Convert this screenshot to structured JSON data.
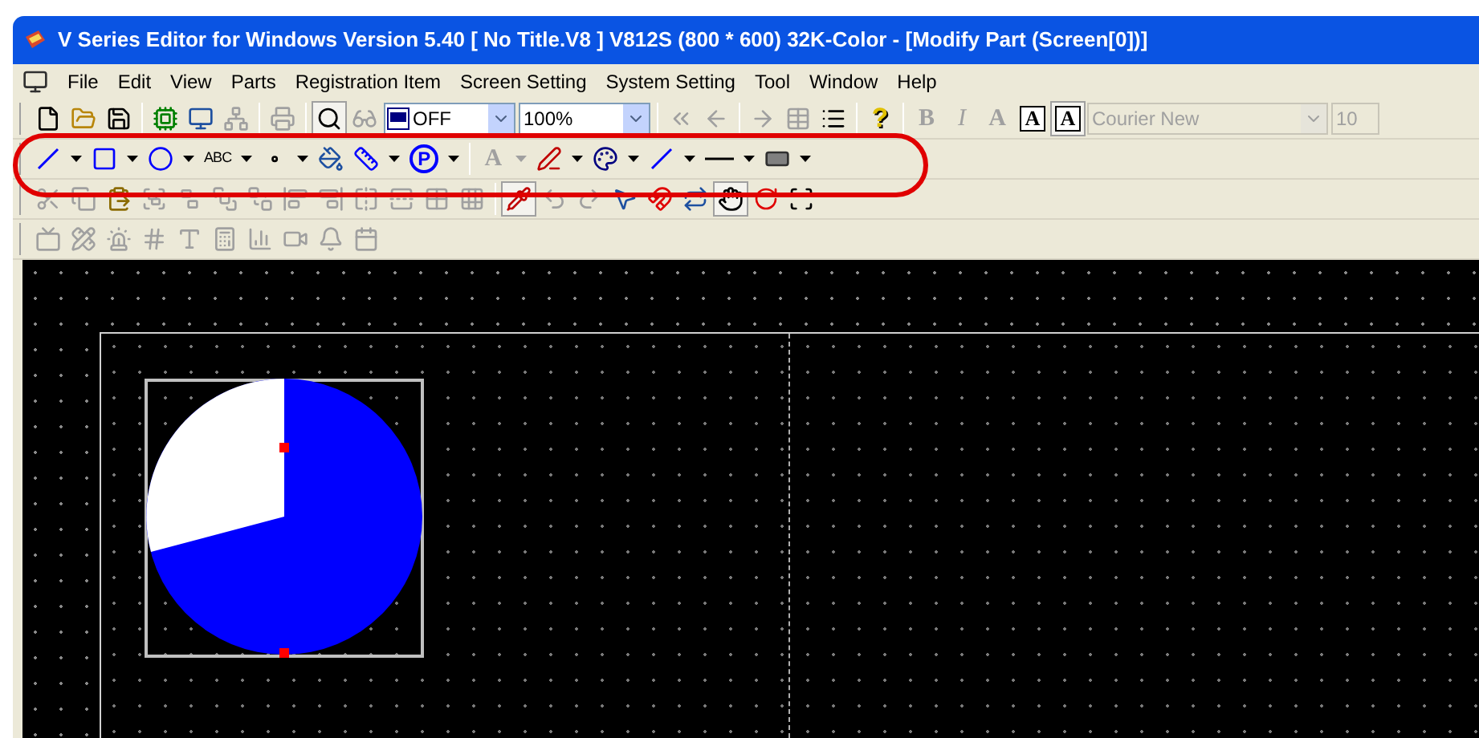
{
  "window": {
    "title": "V Series Editor for Windows Version 5.40 [ No Title.V8 ] V812S (800 * 600) 32K-Color - [Modify Part (Screen[0])]"
  },
  "menu": [
    {
      "label": "File"
    },
    {
      "label": "Edit"
    },
    {
      "label": "View"
    },
    {
      "label": "Parts"
    },
    {
      "label": "Registration Item"
    },
    {
      "label": "Screen Setting"
    },
    {
      "label": "System Setting"
    },
    {
      "label": "Tool"
    },
    {
      "label": "Window"
    },
    {
      "label": "Help"
    }
  ],
  "toolbars": [
    {
      "items": [
        {
          "kind": "file",
          "disabled": false,
          "pressed": false
        },
        {
          "kind": "folder",
          "disabled": false,
          "pressed": false
        },
        {
          "kind": "save",
          "disabled": false,
          "pressed": false
        },
        {
          "kind": "separator"
        },
        {
          "kind": "transfer",
          "disabled": false,
          "pressed": false
        },
        {
          "kind": "sim",
          "disabled": false,
          "pressed": false
        },
        {
          "kind": "network",
          "disabled": true,
          "pressed": false
        },
        {
          "kind": "separator"
        },
        {
          "kind": "printer",
          "disabled": true,
          "pressed": false
        },
        {
          "kind": "separator"
        },
        {
          "kind": "zoom",
          "disabled": false,
          "pressed": true
        },
        {
          "kind": "glasses",
          "disabled": true,
          "pressed": false
        },
        {
          "kind": "dropdown",
          "value": "OFF",
          "disabled": false,
          "icon": true
        },
        {
          "kind": "dropdown",
          "value": "100%",
          "disabled": false,
          "icon": false
        },
        {
          "kind": "separator"
        },
        {
          "kind": "rewind",
          "disabled": true,
          "pressed": false
        },
        {
          "kind": "back",
          "disabled": true,
          "pressed": false
        },
        {
          "kind": "separator"
        },
        {
          "kind": "forward",
          "disabled": true,
          "pressed": false
        },
        {
          "kind": "table",
          "disabled": true,
          "pressed": false
        },
        {
          "kind": "list",
          "disabled": false,
          "pressed": false
        },
        {
          "kind": "separator"
        },
        {
          "kind": "help",
          "text": "?",
          "disabled": false,
          "pressed": false
        },
        {
          "kind": "separator"
        },
        {
          "kind": "bold",
          "text": "B",
          "disabled": true,
          "pressed": false
        },
        {
          "kind": "italic",
          "text": "I",
          "disabled": true,
          "pressed": false
        },
        {
          "kind": "fontcolor",
          "text": "A",
          "disabled": true,
          "pressed": false
        },
        {
          "kind": "boxed",
          "text": "A",
          "disabled": false,
          "pressed": false
        },
        {
          "kind": "boxed",
          "text": "A",
          "disabled": false,
          "pressed": true
        },
        {
          "kind": "fontbox",
          "value": "Courier New",
          "disabled": true
        },
        {
          "kind": "sizebox",
          "value": "10",
          "disabled": true
        }
      ]
    },
    {
      "items": [
        {
          "kind": "line",
          "disabled": false,
          "pressed": false,
          "caret": true
        },
        {
          "kind": "rect",
          "disabled": false,
          "pressed": false,
          "caret": true
        },
        {
          "kind": "circle",
          "disabled": false,
          "pressed": false,
          "caret": true
        },
        {
          "kind": "textglyph",
          "text": "ABC",
          "disabled": false,
          "pressed": false,
          "caret": true
        },
        {
          "kind": "dot",
          "disabled": false,
          "pressed": false,
          "caret": true
        },
        {
          "kind": "paint",
          "disabled": false,
          "pressed": false
        },
        {
          "kind": "scale",
          "disabled": false,
          "pressed": false,
          "caret": true
        },
        {
          "kind": "pcircle",
          "text": "P",
          "disabled": false,
          "pressed": false,
          "caret": true
        },
        {
          "kind": "separator"
        },
        {
          "kind": "fontcolor",
          "text": "A",
          "disabled": true,
          "pressed": false,
          "caret": true
        },
        {
          "kind": "pen",
          "disabled": false,
          "pressed": false,
          "caret": true
        },
        {
          "kind": "palette",
          "disabled": false,
          "pressed": false,
          "caret": true
        },
        {
          "kind": "line",
          "disabled": false,
          "pressed": false,
          "caret": true
        },
        {
          "kind": "hline",
          "disabled": false,
          "pressed": false,
          "caret": true
        },
        {
          "kind": "fillrect",
          "disabled": false,
          "pressed": false,
          "caret": true
        }
      ]
    },
    {
      "items": [
        {
          "kind": "cut",
          "disabled": true,
          "pressed": false
        },
        {
          "kind": "copy",
          "disabled": true,
          "pressed": false
        },
        {
          "kind": "paste",
          "disabled": false,
          "pressed": false
        },
        {
          "kind": "group",
          "disabled": true,
          "pressed": false
        },
        {
          "kind": "ungroup",
          "disabled": true,
          "pressed": false
        },
        {
          "kind": "front",
          "disabled": true,
          "pressed": false
        },
        {
          "kind": "tail",
          "disabled": true,
          "pressed": false
        },
        {
          "kind": "alignl",
          "disabled": true,
          "pressed": false
        },
        {
          "kind": "alignr",
          "disabled": true,
          "pressed": false
        },
        {
          "kind": "flip",
          "disabled": true,
          "pressed": false
        },
        {
          "kind": "flipv",
          "disabled": true,
          "pressed": false
        },
        {
          "kind": "grid",
          "disabled": true,
          "pressed": false
        },
        {
          "kind": "grid3",
          "disabled": true,
          "pressed": false
        },
        {
          "kind": "separator"
        },
        {
          "kind": "picker",
          "disabled": false,
          "pressed": true
        },
        {
          "kind": "undo",
          "disabled": true,
          "pressed": false
        },
        {
          "kind": "redo",
          "disabled": true,
          "pressed": false
        },
        {
          "kind": "pointer",
          "disabled": false,
          "pressed": false
        },
        {
          "kind": "magnet",
          "disabled": false,
          "pressed": false
        },
        {
          "kind": "swap",
          "disabled": false,
          "pressed": false
        },
        {
          "kind": "hand",
          "disabled": false,
          "pressed": true
        },
        {
          "kind": "ring",
          "disabled": false,
          "pressed": false
        },
        {
          "kind": "handles",
          "disabled": false,
          "pressed": false
        }
      ]
    },
    {
      "items": [
        {
          "kind": "screen",
          "disabled": true,
          "pressed": false
        },
        {
          "kind": "draw",
          "disabled": true,
          "pressed": false
        },
        {
          "kind": "lamp",
          "disabled": true,
          "pressed": false
        },
        {
          "kind": "num",
          "disabled": true,
          "pressed": false
        },
        {
          "kind": "letters",
          "disabled": true,
          "pressed": false
        },
        {
          "kind": "calc",
          "disabled": true,
          "pressed": false
        },
        {
          "kind": "chart",
          "disabled": true,
          "pressed": false
        },
        {
          "kind": "video",
          "disabled": true,
          "pressed": false
        },
        {
          "kind": "bell",
          "disabled": true,
          "pressed": false
        },
        {
          "kind": "date",
          "disabled": true,
          "pressed": false
        }
      ]
    }
  ],
  "annotation": {
    "shown": true
  }
}
